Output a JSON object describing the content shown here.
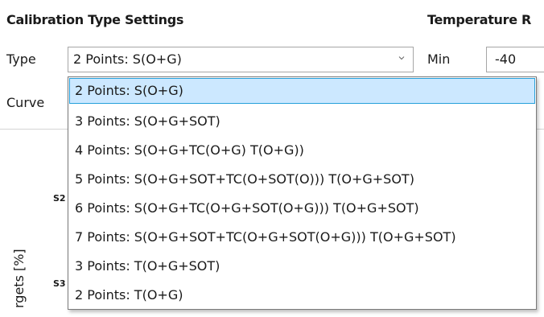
{
  "headings": {
    "calibration_type_settings": "Calibration Type Settings",
    "temperature_partial": "Temperature R"
  },
  "form": {
    "type_label": "Type",
    "curve_label": "Curve",
    "type_selected": "2 Points: S(O+G)",
    "min_label": "Min",
    "min_value": "-40"
  },
  "dropdown": {
    "options": [
      "2 Points: S(O+G)",
      "3 Points: S(O+G+SOT)",
      "4 Points: S(O+G+TC(O+G) T(O+G))",
      "5 Points: S(O+G+SOT+TC(O+SOT(O))) T(O+G+SOT)",
      "6 Points: S(O+G+TC(O+G+SOT(O+G))) T(O+G+SOT)",
      "7 Points: S(O+G+SOT+TC(O+G+SOT(O+G))) T(O+G+SOT)",
      "3 Points: T(O+G+SOT)",
      "2 Points: T(O+G)"
    ],
    "selected_index": 0
  },
  "chart_background": {
    "y_axis_label_partial": "rgets [%]",
    "tick_s2": "S2",
    "tick_s3": "S3"
  },
  "colors": {
    "selection_bg": "#cce8ff",
    "selection_border": "#26a0da"
  },
  "icons": {
    "combo_arrow": "chevron-down-icon"
  }
}
